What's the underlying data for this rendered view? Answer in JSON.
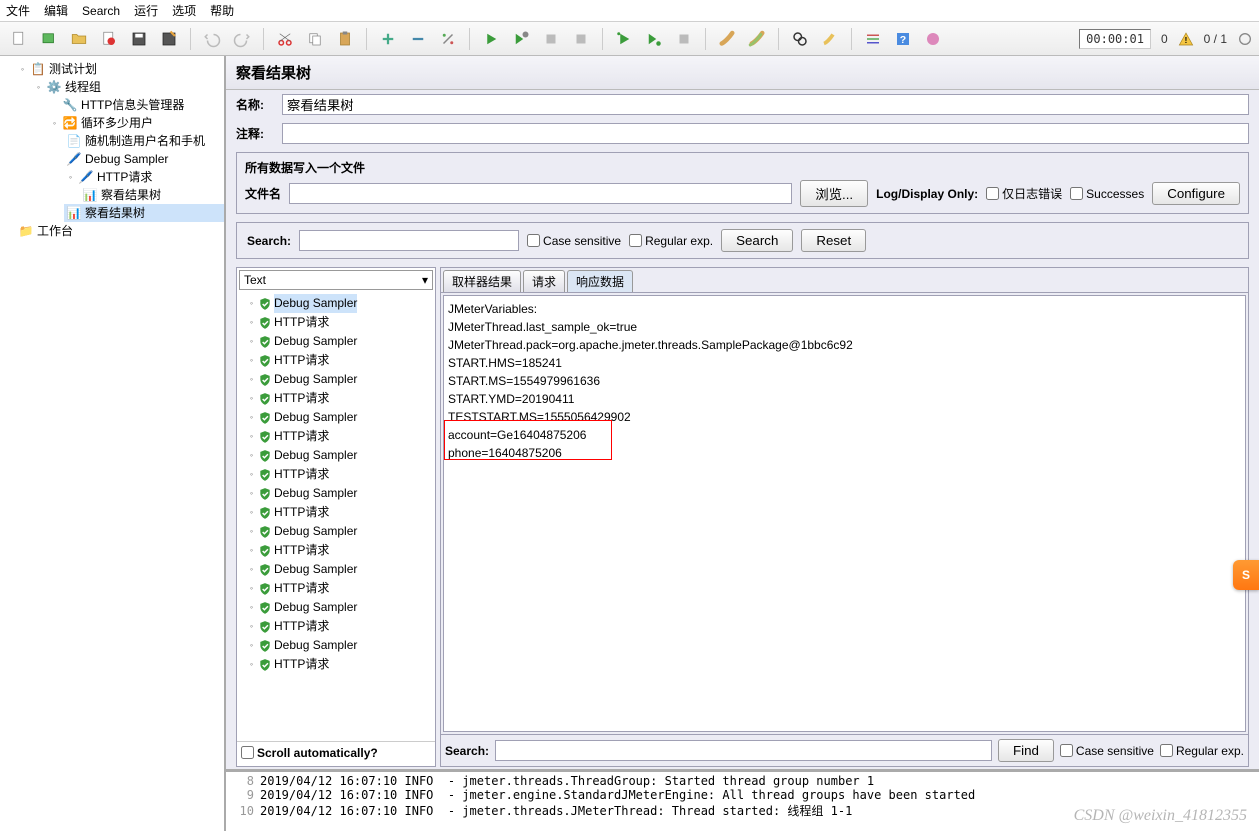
{
  "menu": [
    "文件",
    "编辑",
    "Search",
    "运行",
    "选项",
    "帮助"
  ],
  "toolbar_timer": "00:00:01",
  "toolbar_count1": "0",
  "toolbar_count2": "0 / 1",
  "tree": {
    "root": "测试计划",
    "thread_group": "线程组",
    "http_header_mgr": "HTTP信息头管理器",
    "loop_ctrl": "循环多少用户",
    "random_user": "随机制造用户名和手机",
    "debug_sampler": "Debug Sampler",
    "http_req": "HTTP请求",
    "view_results1": "察看结果树",
    "view_results2": "察看结果树",
    "workbench": "工作台"
  },
  "panel": {
    "title": "察看结果树",
    "name_label": "名称:",
    "name_value": "察看结果树",
    "comments_label": "注释:",
    "file_section": "所有数据写入一个文件",
    "file_label": "文件名",
    "browse": "浏览...",
    "log_display": "Log/Display Only:",
    "errors_only": "仅日志错误",
    "successes": "Successes",
    "configure": "Configure"
  },
  "search": {
    "label": "Search:",
    "case_sensitive": "Case sensitive",
    "regex": "Regular exp.",
    "search_btn": "Search",
    "reset_btn": "Reset"
  },
  "renderer": "Text",
  "samples": [
    "Debug Sampler",
    "HTTP请求",
    "Debug Sampler",
    "HTTP请求",
    "Debug Sampler",
    "HTTP请求",
    "Debug Sampler",
    "HTTP请求",
    "Debug Sampler",
    "HTTP请求",
    "Debug Sampler",
    "HTTP请求",
    "Debug Sampler",
    "HTTP请求",
    "Debug Sampler",
    "HTTP请求",
    "Debug Sampler",
    "HTTP请求",
    "Debug Sampler",
    "HTTP请求"
  ],
  "scroll_auto": "Scroll automatically?",
  "tabs": {
    "sampler": "取样器结果",
    "request": "请求",
    "response": "响应数据"
  },
  "response_lines": [
    "JMeterVariables:",
    "JMeterThread.last_sample_ok=true",
    "JMeterThread.pack=org.apache.jmeter.threads.SamplePackage@1bbc6c92",
    "START.HMS=185241",
    "START.MS=1554979961636",
    "START.YMD=20190411",
    "TESTSTART.MS=1555056429902",
    "account=Ge16404875206",
    "phone=16404875206"
  ],
  "find": {
    "label": "Search:",
    "find_btn": "Find",
    "case": "Case sensitive",
    "regex": "Regular exp."
  },
  "log": [
    {
      "n": "8",
      "t": "2019/04/12 16:07:10 INFO  - jmeter.threads.ThreadGroup: Started thread group number 1 "
    },
    {
      "n": "9",
      "t": "2019/04/12 16:07:10 INFO  - jmeter.engine.StandardJMeterEngine: All thread groups have been started "
    },
    {
      "n": "10",
      "t": "2019/04/12 16:07:10 INFO  - jmeter.threads.JMeterThread: Thread started: 线程组 1-1 "
    }
  ],
  "watermark": "CSDN @weixin_41812355",
  "orange_tab": "S"
}
